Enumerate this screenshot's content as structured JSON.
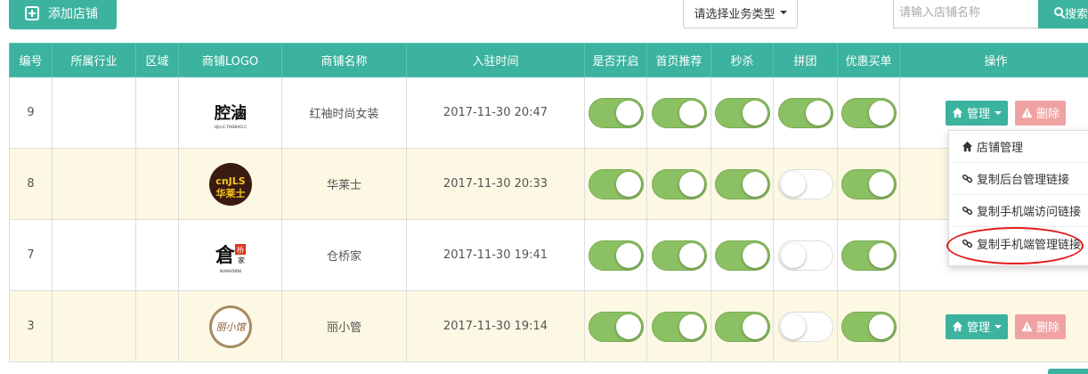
{
  "toolbar": {
    "add_label": "添加店铺",
    "biz_type_label": "请选择业务类型",
    "search_placeholder": "请输入店铺名称",
    "search_label": "搜索"
  },
  "table": {
    "headers": [
      "编号",
      "所属行业",
      "区域",
      "商铺LOGO",
      "商铺名称",
      "入驻时间",
      "是否开启",
      "首页推荐",
      "秒杀",
      "拼团",
      "优惠买单",
      "操作"
    ],
    "rows": [
      {
        "id": "9",
        "industry": "",
        "region": "",
        "logo": "logo-hongxiu",
        "name": "红袖时尚女装",
        "time": "2017-11-30 20:47",
        "open": true,
        "recommend": true,
        "seckill": true,
        "group": true,
        "discount": true
      },
      {
        "id": "8",
        "industry": "",
        "region": "",
        "logo": "logo-cnjls",
        "name": "华莱士",
        "time": "2017-11-30 20:33",
        "open": true,
        "recommend": true,
        "seckill": true,
        "group": false,
        "discount": true
      },
      {
        "id": "7",
        "industry": "",
        "region": "",
        "logo": "logo-cangqiaojia",
        "name": "仓桥家",
        "time": "2017-11-30 19:41",
        "open": true,
        "recommend": true,
        "seckill": true,
        "group": false,
        "discount": true
      },
      {
        "id": "3",
        "industry": "",
        "region": "",
        "logo": "logo-lixiaoguan",
        "name": "丽小管",
        "time": "2017-11-30 19:14",
        "open": true,
        "recommend": true,
        "seckill": true,
        "group": false,
        "discount": true
      }
    ],
    "logo_texts": {
      "hongxiu_glyphs": "腔滷",
      "hongxiu_url": "HJU.E.TAOBAO.C",
      "cnjls_main": "cnJLS",
      "cnjls_cn": "华莱士",
      "cqj_big": "倉",
      "cqj_small": "桥",
      "cqj_small2": "家",
      "cqj_sub": "NANAOBNI",
      "lxg_text": "丽小馆"
    }
  },
  "actions": {
    "manage_label": "管理",
    "delete_label": "删除"
  },
  "dropdown": {
    "items": [
      "店铺管理",
      "复制后台管理链接",
      "复制手机端访问链接",
      "复制手机端管理链接"
    ]
  },
  "colors": {
    "primary": "#3bb39e",
    "toggle_on": "#8bc063",
    "delete": "#f0a2a2",
    "highlight": "#e31b1b",
    "row_alt": "#fcf8e3"
  }
}
